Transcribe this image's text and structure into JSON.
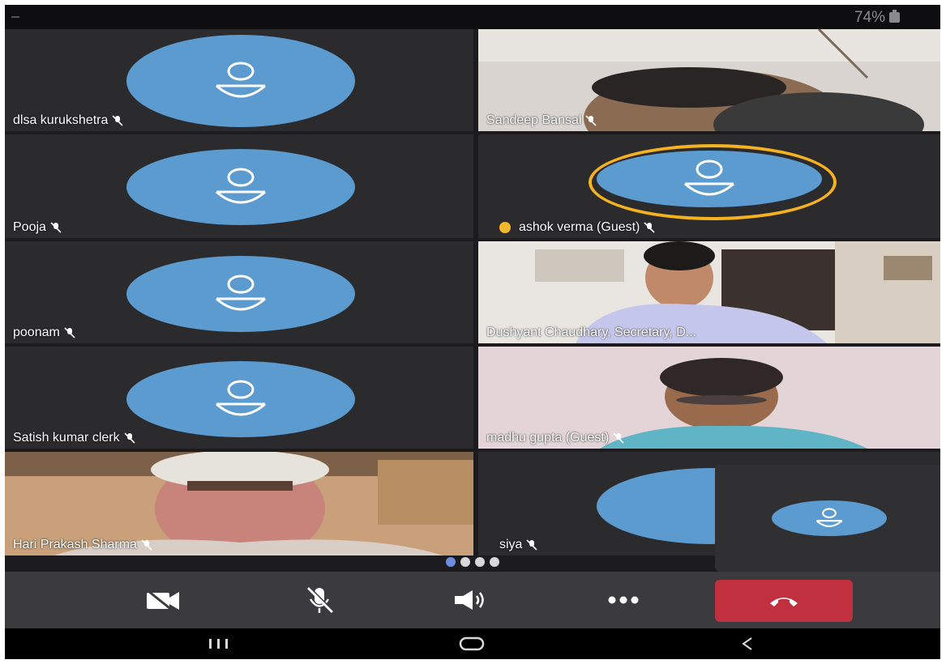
{
  "status_bar": {
    "battery": "74%"
  },
  "participants": [
    {
      "name": "dlsa kurukshetra",
      "video": false
    },
    {
      "name": "Sandeep Bansal",
      "video": true
    },
    {
      "name": "Pooja",
      "video": false
    },
    {
      "name": "ashok verma (Guest)",
      "video": false,
      "hand_raised": true,
      "speaking": true
    },
    {
      "name": "poonam",
      "video": false
    },
    {
      "name": "Dushyant Chaudhary, Secretary, D...",
      "video": true,
      "highlighted": true
    },
    {
      "name": "Satish kumar clerk",
      "video": false
    },
    {
      "name": "madhu gupta (Guest)",
      "video": true
    },
    {
      "name": "Hari Prakash Sharma",
      "video": true
    },
    {
      "name": "siya",
      "video": false
    }
  ],
  "pagination": {
    "pages": 4,
    "current": 1
  },
  "controls": [
    {
      "name": "camera-off-icon"
    },
    {
      "name": "mic-off-icon"
    },
    {
      "name": "speaker-icon"
    },
    {
      "name": "more-options-icon"
    },
    {
      "name": "end-call-icon"
    }
  ],
  "colors": {
    "avatar": "#5b9bd0",
    "speaking_ring": "#f5b21f",
    "end_call": "#c0303f",
    "active_dot": "#6f8de0",
    "highlight": "#8f87e8"
  }
}
